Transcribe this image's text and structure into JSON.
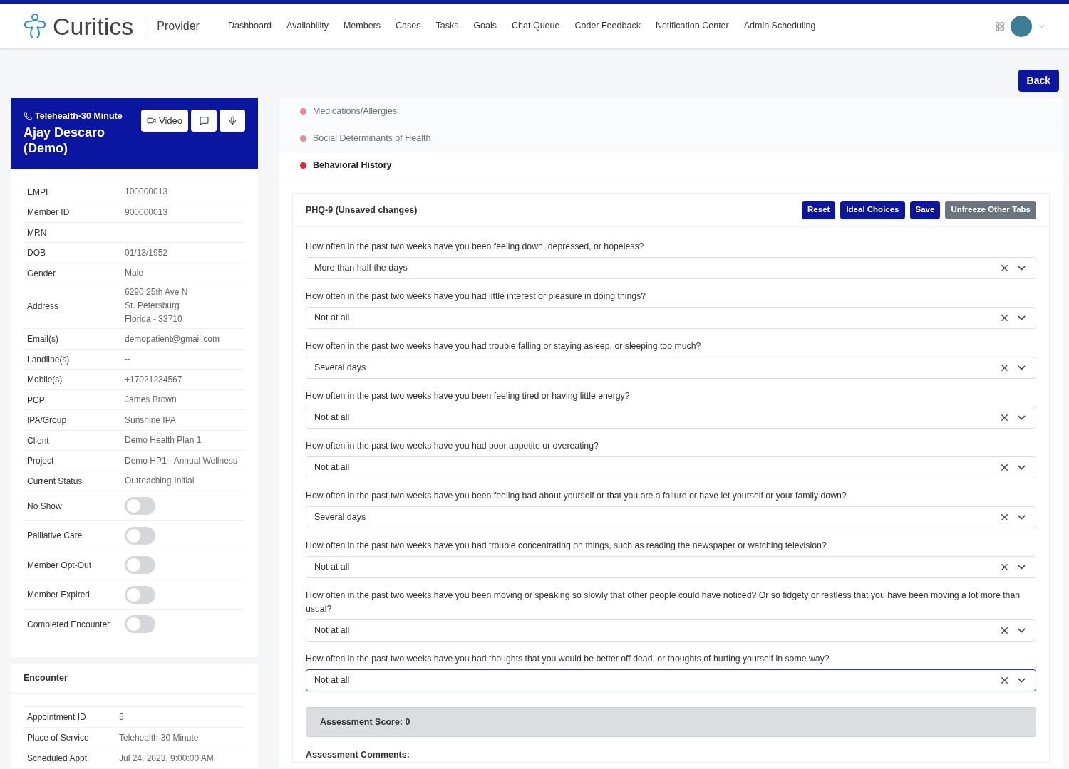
{
  "brand": {
    "name": "Curitics",
    "role": "Provider"
  },
  "nav": [
    "Dashboard",
    "Availability",
    "Members",
    "Cases",
    "Tasks",
    "Goals",
    "Chat Queue",
    "Coder Feedback",
    "Notification Center",
    "Admin Scheduling"
  ],
  "back_button": "Back",
  "member_card": {
    "visit_type": "Telehealth-30 Minute",
    "name": "Ajay Descaro (Demo)",
    "video_button": "Video"
  },
  "member_fields": [
    {
      "label": "EMPI",
      "value": [
        "100000013"
      ]
    },
    {
      "label": "Member ID",
      "value": [
        "900000013"
      ]
    },
    {
      "label": "MRN"
    },
    {
      "label": "DOB",
      "value": [
        "01/13/1952"
      ]
    },
    {
      "label": "Gender",
      "value": [
        "Male"
      ]
    },
    {
      "label": "Address",
      "value": [
        "6290 25th Ave N",
        "St. Petersburg",
        "Florida - 33710"
      ]
    },
    {
      "label": "Email(s)",
      "value": [
        "demopatient@gmail.com"
      ]
    },
    {
      "label": "Landline(s)",
      "value": [
        "--"
      ]
    },
    {
      "label": "Mobile(s)",
      "value": [
        "+17021234567"
      ]
    },
    {
      "label": "PCP",
      "value": [
        "James Brown"
      ]
    },
    {
      "label": "IPA/Group",
      "value": [
        "Sunshine IPA"
      ]
    },
    {
      "label": "Client",
      "value": [
        "Demo Health Plan 1"
      ]
    },
    {
      "label": "Project",
      "value": [
        "Demo HP1 - Annual Wellness"
      ]
    },
    {
      "label": "Current Status",
      "value": [
        "Outreaching-Initial"
      ]
    }
  ],
  "toggles": [
    {
      "label": "No Show",
      "on": false
    },
    {
      "label": "Palliative Care",
      "on": false
    },
    {
      "label": "Member Opt-Out",
      "on": false
    },
    {
      "label": "Member Expired",
      "on": false
    },
    {
      "label": "Completed Encounter",
      "on": false
    }
  ],
  "encounter": {
    "title": "Encounter",
    "fields": [
      {
        "label": "Appointment ID",
        "value": "5"
      },
      {
        "label": "Place of Service",
        "value": "Telehealth-30 Minute"
      },
      {
        "label": "Scheduled Appt",
        "value": "Jul 24, 2023, 9:00:00 AM"
      }
    ]
  },
  "sections": [
    {
      "label": "Medications/Allergies",
      "selected": false
    },
    {
      "label": "Social Determinants of Health",
      "selected": false
    },
    {
      "label": "Behavioral History",
      "selected": true
    }
  ],
  "form": {
    "title": "PHQ-9 (Unsaved changes)",
    "buttons": [
      {
        "label": "Reset",
        "kind": "primary"
      },
      {
        "label": "Ideal Choices",
        "kind": "primary"
      },
      {
        "label": "Save",
        "kind": "primary"
      },
      {
        "label": "Unfreeze Other Tabs",
        "kind": "secondary"
      }
    ],
    "questions": [
      {
        "text": "How often in the past two weeks have you been feeling down, depressed, or hopeless?",
        "answer": "More than half the days",
        "focused": false
      },
      {
        "text": "How often in the past two weeks have you had little interest or pleasure in doing things?",
        "answer": "Not at all",
        "focused": false
      },
      {
        "text": "How often in the past two weeks have you had trouble falling or staying asleep, or sleeping too much?",
        "answer": "Several days",
        "focused": false
      },
      {
        "text": "How often in the past two weeks have you been feeling tired or having little energy?",
        "answer": "Not at all",
        "focused": false
      },
      {
        "text": "How often in the past two weeks have you had poor appetite or overeating?",
        "answer": "Not at all",
        "focused": false
      },
      {
        "text": "How often in the past two weeks have you been feeling bad about yourself or that you are a failure or have let yourself or your family down?",
        "answer": "Several days",
        "focused": false
      },
      {
        "text": "How often in the past two weeks have you had trouble concentrating on things, such as reading the newspaper or watching television?",
        "answer": "Not at all",
        "focused": false
      },
      {
        "text": "How often in the past two weeks have you been moving or speaking so slowly that other people could have noticed? Or so fidgety or restless that you have been moving a lot more than usual?",
        "answer": "Not at all",
        "focused": false
      },
      {
        "text": "How often in the past two weeks have you had thoughts that you would be better off dead, or thoughts of hurting yourself in some way?",
        "answer": "Not at all",
        "focused": true
      }
    ],
    "score": "Assessment Score: 0",
    "comments_label": "Assessment Comments:"
  }
}
